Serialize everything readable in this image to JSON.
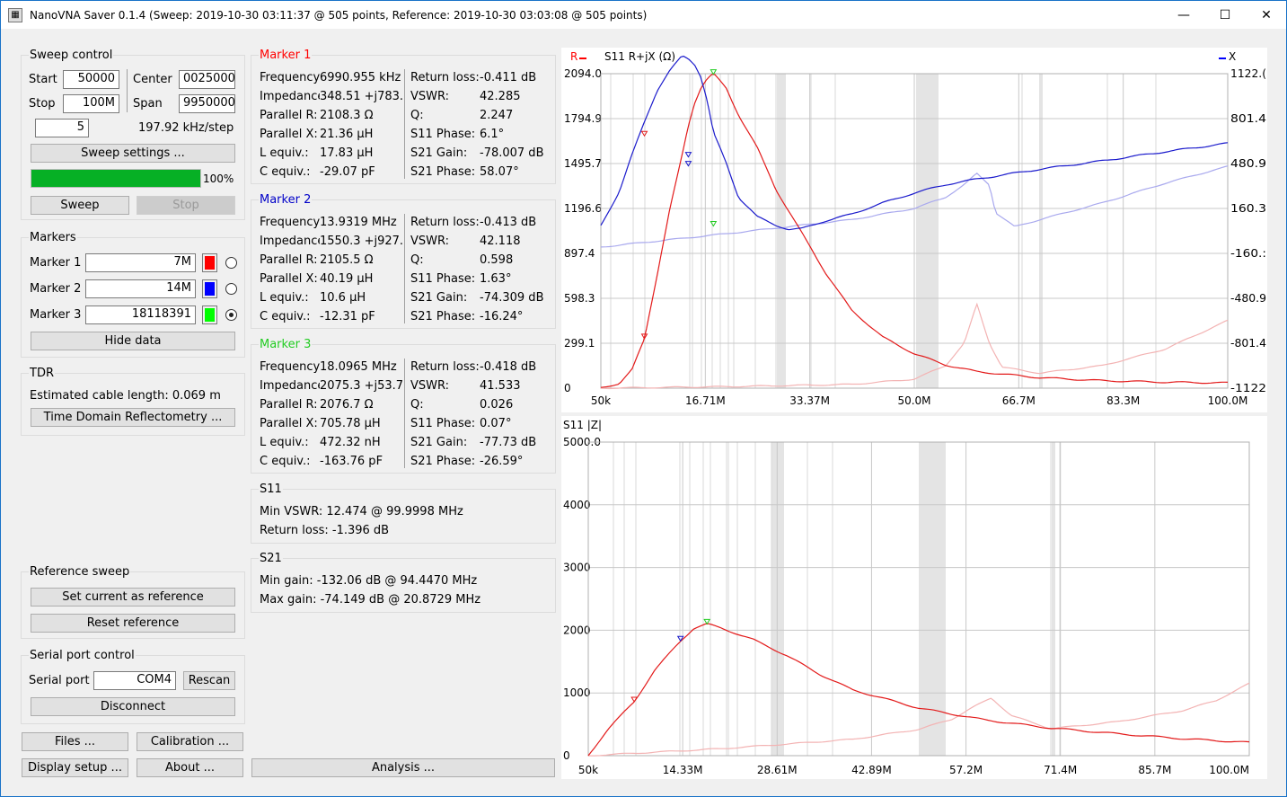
{
  "window": {
    "title": "NanoVNA Saver 0.1.4 (Sweep: 2019-10-30 03:11:37 @ 505 points, Reference: 2019-10-30 03:03:08 @ 505 points)",
    "controls": [
      "—",
      "☐",
      "✕"
    ]
  },
  "sweep": {
    "title": "Sweep control",
    "start_label": "Start",
    "start_value": "50000",
    "center_label": "Center",
    "center_value": "0025000",
    "stop_label": "Stop",
    "stop_value": "100M",
    "span_label": "Span",
    "span_value": "9950000",
    "count_value": "5",
    "step_text": "197.92 kHz/step",
    "settings_button": "Sweep settings ...",
    "progress": 100,
    "progress_text": "100%",
    "sweep_button": "Sweep",
    "stop_button": "Stop"
  },
  "markers": {
    "title": "Markers",
    "items": [
      {
        "label": "Marker 1",
        "value": "7M",
        "color": "#ff0000",
        "selected": false
      },
      {
        "label": "Marker 2",
        "value": "14M",
        "color": "#0000ff",
        "selected": false
      },
      {
        "label": "Marker 3",
        "value": "18118391",
        "color": "#00ff00",
        "selected": true
      }
    ],
    "hide_button": "Hide data"
  },
  "tdr": {
    "title": "TDR",
    "cable_text": "Estimated cable length: 0.069 m",
    "button": "Time Domain Reflectometry ..."
  },
  "reference": {
    "title": "Reference sweep",
    "set_button": "Set current as reference",
    "reset_button": "Reset reference"
  },
  "serial": {
    "title": "Serial port control",
    "port_label": "Serial port",
    "port_value": "COM4",
    "rescan_button": "Rescan",
    "disconnect_button": "Disconnect"
  },
  "bottom_buttons": {
    "files": "Files ...",
    "calibration": "Calibration ...",
    "display": "Display setup ...",
    "about": "About ...",
    "analysis": "Analysis ..."
  },
  "marker_data": [
    {
      "title": "Marker 1",
      "color": "#ff0000",
      "left": [
        [
          "Frequency:",
          "6990.955 kHz"
        ],
        [
          "Impedance:",
          "348.51 +j783."
        ],
        [
          "Parallel R:",
          "2108.3 Ω"
        ],
        [
          "Parallel X:",
          "21.36 µH"
        ],
        [
          "L equiv.:",
          "17.83 µH"
        ],
        [
          "C equiv.:",
          "-29.07 pF"
        ]
      ],
      "right": [
        [
          "Return loss:",
          "-0.411 dB"
        ],
        [
          "VSWR:",
          "42.285"
        ],
        [
          "Q:",
          "2.247"
        ],
        [
          "S11 Phase:",
          "6.1°"
        ],
        [
          "S21 Gain:",
          "-78.007 dB"
        ],
        [
          "S21 Phase:",
          "58.07°"
        ]
      ]
    },
    {
      "title": "Marker 2",
      "color": "#0000c8",
      "left": [
        [
          "Frequency:",
          "13.9319 MHz"
        ],
        [
          "Impedance:",
          "1550.3 +j927."
        ],
        [
          "Parallel R:",
          "2105.5 Ω"
        ],
        [
          "Parallel X:",
          "40.19 µH"
        ],
        [
          "L equiv.:",
          "10.6 µH"
        ],
        [
          "C equiv.:",
          "-12.31 pF"
        ]
      ],
      "right": [
        [
          "Return loss:",
          "-0.413 dB"
        ],
        [
          "VSWR:",
          "42.118"
        ],
        [
          "Q:",
          "0.598"
        ],
        [
          "S11 Phase:",
          "1.63°"
        ],
        [
          "S21 Gain:",
          "-74.309 dB"
        ],
        [
          "S21 Phase:",
          "-16.24°"
        ]
      ]
    },
    {
      "title": "Marker 3",
      "color": "#22cc22",
      "left": [
        [
          "Frequency:",
          "18.0965 MHz"
        ],
        [
          "Impedance:",
          "2075.3 +j53.7"
        ],
        [
          "Parallel R:",
          "2076.7 Ω"
        ],
        [
          "Parallel X:",
          "705.78 µH"
        ],
        [
          "L equiv.:",
          "472.32 nH"
        ],
        [
          "C equiv.:",
          "-163.76 pF"
        ]
      ],
      "right": [
        [
          "Return loss:",
          "-0.418 dB"
        ],
        [
          "VSWR:",
          "41.533"
        ],
        [
          "Q:",
          "0.026"
        ],
        [
          "S11 Phase:",
          "0.07°"
        ],
        [
          "S21 Gain:",
          "-77.73 dB"
        ],
        [
          "S21 Phase:",
          "-26.59°"
        ]
      ]
    }
  ],
  "s11_summary": {
    "title": "S11",
    "vswr_text": "Min VSWR:  12.474 @ 99.9998 MHz",
    "rl_text": "Return loss: -1.396 dB"
  },
  "s21_summary": {
    "title": "S21",
    "min_text": "Min gain:  -132.06 dB @ 94.4470 MHz",
    "max_text": "Max gain:  -74.149 dB @ 20.8729 MHz"
  },
  "chart_data": [
    {
      "type": "line",
      "title": "S11  R+jX (Ω)",
      "legend": [
        {
          "name": "R",
          "color": "#ff0000"
        },
        {
          "name": "X",
          "color": "#0000ff"
        }
      ],
      "x_ticks": [
        "50k",
        "16.71M",
        "33.37M",
        "50.0M",
        "66.7M",
        "83.3M",
        "100.0M"
      ],
      "xlim": [
        0.05,
        100
      ],
      "y_left_ticks": [
        "2094.0",
        "1794.9",
        "1495.7",
        "1196.6",
        "897.4",
        "598.3",
        "299.1",
        "0"
      ],
      "ylim_left": [
        0,
        2094
      ],
      "y_right_ticks": [
        "1122.(",
        "801.4",
        "480.9",
        "160.3",
        "-160.:",
        "-480.9",
        "-801.4",
        "-1122"
      ],
      "ylim_right": [
        -1122,
        1122
      ],
      "series": [
        {
          "name": "R",
          "color": "#e31a1a",
          "x": [
            0.05,
            3,
            5,
            7,
            9,
            11,
            13,
            14,
            15,
            16,
            17,
            18,
            20,
            22,
            25,
            28,
            32,
            36,
            40,
            45,
            50,
            55,
            60,
            70,
            80,
            90,
            100
          ],
          "y": [
            5,
            30,
            120,
            330,
            750,
            1180,
            1550,
            1750,
            1900,
            2000,
            2060,
            2094,
            2000,
            1820,
            1600,
            1320,
            1040,
            760,
            520,
            340,
            230,
            155,
            110,
            70,
            50,
            40,
            35
          ]
        },
        {
          "name": "X",
          "color": "#1a1acc",
          "x": [
            0.05,
            3,
            5,
            7,
            9,
            11,
            13,
            14,
            15,
            16,
            17,
            18,
            20,
            22,
            25,
            28,
            30,
            32,
            35,
            40,
            45,
            50,
            55,
            60,
            70,
            80,
            90,
            100
          ],
          "y": [
            40,
            280,
            540,
            780,
            1000,
            1140,
            1250,
            1230,
            1190,
            1100,
            930,
            700,
            490,
            240,
            100,
            40,
            10,
            15,
            60,
            120,
            200,
            270,
            330,
            370,
            440,
            500,
            565,
            625
          ]
        },
        {
          "name": "R reference",
          "color": "#f3b3b3",
          "x": [
            0.05,
            20,
            40,
            50,
            55,
            58,
            60,
            62,
            64,
            70,
            80,
            90,
            100
          ],
          "y": [
            0,
            10,
            25,
            60,
            150,
            300,
            560,
            300,
            140,
            100,
            150,
            260,
            450
          ]
        },
        {
          "name": "X reference",
          "color": "#a9a9ee",
          "x": [
            0.05,
            20,
            30,
            40,
            50,
            55,
            58,
            60,
            62,
            63,
            66,
            70,
            80,
            90,
            100
          ],
          "y": [
            -115,
            -20,
            30,
            80,
            160,
            240,
            330,
            410,
            330,
            130,
            30,
            80,
            200,
            340,
            460
          ]
        }
      ]
    },
    {
      "type": "line",
      "title": "S11 |Z|",
      "x_ticks": [
        "50k",
        "14.33M",
        "28.61M",
        "42.89M",
        "57.2M",
        "71.4M",
        "85.7M",
        "100.0M"
      ],
      "xlim": [
        0.05,
        100
      ],
      "y_ticks": [
        "5000.0",
        "4000",
        "3000",
        "2000",
        "1000",
        "0"
      ],
      "ylim": [
        0,
        5000
      ],
      "series": [
        {
          "name": "|Z|",
          "color": "#e31a1a",
          "x": [
            0.05,
            3,
            7,
            10,
            14,
            16,
            18,
            20,
            25,
            30,
            35,
            40,
            50,
            60,
            70,
            80,
            90,
            100
          ],
          "y": [
            0,
            420,
            860,
            1350,
            1830,
            2030,
            2100,
            2040,
            1850,
            1600,
            1300,
            1050,
            760,
            570,
            440,
            350,
            270,
            210
          ]
        },
        {
          "name": "|Z| reference",
          "color": "#f3b3b3",
          "x": [
            0.05,
            20,
            40,
            50,
            55,
            58,
            61,
            64,
            70,
            80,
            90,
            95,
            100
          ],
          "y": [
            0,
            110,
            260,
            420,
            580,
            760,
            920,
            640,
            430,
            540,
            720,
            880,
            1150
          ]
        }
      ]
    }
  ]
}
